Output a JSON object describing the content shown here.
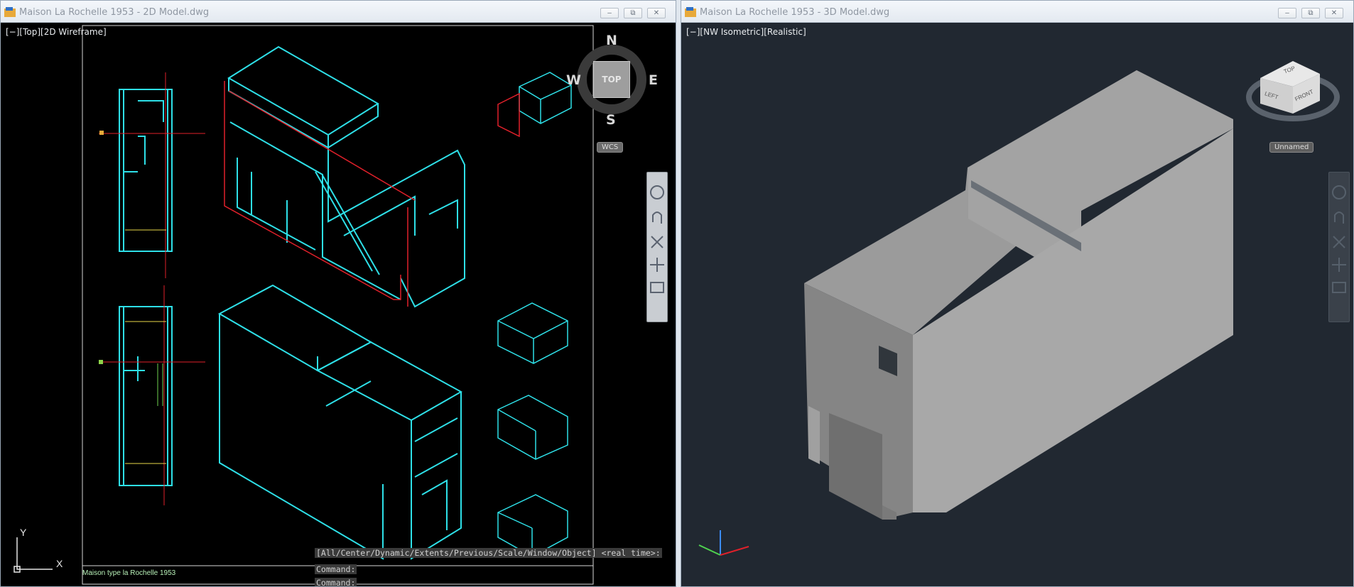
{
  "left_window": {
    "title": "Maison La Rochelle 1953 - 2D Model.dwg",
    "viewport_label": "[−][Top][2D Wireframe]",
    "compass": {
      "n": "N",
      "s": "S",
      "e": "E",
      "w": "W",
      "top": "TOP"
    },
    "ucs_menu": "WCS",
    "sheet_label": "Maison type la Rochelle 1953",
    "ucs_x": "X",
    "ucs_y": "Y",
    "command_prompt": "[All/Center/Dynamic/Extents/Previous/Scale/Window/Object] <real time>:",
    "command_lines": [
      "Command:",
      "Command:"
    ]
  },
  "right_window": {
    "title": "Maison La Rochelle 1953 - 3D Model.dwg",
    "viewport_label": "[−][NW Isometric][Realistic]",
    "viewcube": {
      "top": "TOP",
      "left": "LEFT",
      "front": "FRONT"
    },
    "ucs_menu": "Unnamed"
  },
  "window_buttons": {
    "minimize": "–",
    "restore": "⧉",
    "close": "✕"
  },
  "colors": {
    "wire_cyan": "#2ee0e8",
    "wire_red": "#e0202a",
    "solid_top": "#9b9b9b",
    "solid_left": "#858585",
    "solid_right": "#a8a8a8",
    "bg_3d": "#212831"
  },
  "icons": [
    "app-icon",
    "pan-icon",
    "zoom-icon",
    "orbit-icon",
    "steering-wheel-icon",
    "showmotion-icon"
  ]
}
